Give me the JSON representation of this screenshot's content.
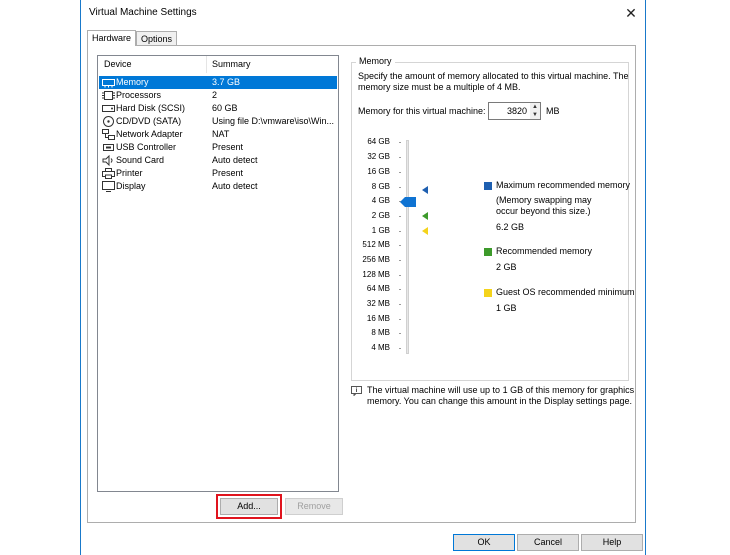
{
  "window": {
    "title": "Virtual Machine Settings"
  },
  "tabs": [
    {
      "label": "Hardware"
    },
    {
      "label": "Options"
    }
  ],
  "device_list": {
    "headers": {
      "device": "Device",
      "summary": "Summary"
    },
    "rows": [
      {
        "device": "Memory",
        "summary": "3.7 GB",
        "icon": "memory-icon",
        "selected": true
      },
      {
        "device": "Processors",
        "summary": "2",
        "icon": "processor-icon"
      },
      {
        "device": "Hard Disk (SCSI)",
        "summary": "60 GB",
        "icon": "hard-disk-icon"
      },
      {
        "device": "CD/DVD (SATA)",
        "summary": "Using file D:\\vmware\\iso\\Win...",
        "icon": "cd-dvd-icon"
      },
      {
        "device": "Network Adapter",
        "summary": "NAT",
        "icon": "network-adapter-icon"
      },
      {
        "device": "USB Controller",
        "summary": "Present",
        "icon": "usb-controller-icon"
      },
      {
        "device": "Sound Card",
        "summary": "Auto detect",
        "icon": "sound-card-icon"
      },
      {
        "device": "Printer",
        "summary": "Present",
        "icon": "printer-icon"
      },
      {
        "device": "Display",
        "summary": "Auto detect",
        "icon": "display-icon"
      }
    ]
  },
  "list_buttons": {
    "add": "Add...",
    "remove": "Remove"
  },
  "memory": {
    "group_label": "Memory",
    "description_line1": "Specify the amount of memory allocated to this virtual machine. The",
    "description_line2": "memory size must be a multiple of 4 MB.",
    "field_label": "Memory for this virtual machine:",
    "value": "3820",
    "unit": "MB",
    "scale_labels": [
      "64 GB",
      "32 GB",
      "16 GB",
      "8 GB",
      "4 GB",
      "2 GB",
      "1 GB",
      "512 MB",
      "256 MB",
      "128 MB",
      "64 MB",
      "32 MB",
      "16 MB",
      "8 MB",
      "4 MB"
    ],
    "legend": {
      "max_label": "Maximum recommended memory",
      "max_note_line1": "(Memory swapping may",
      "max_note_line2": "occur beyond this size.)",
      "max_value": "6.2 GB",
      "rec_label": "Recommended memory",
      "rec_value": "2 GB",
      "guest_label": "Guest OS recommended minimum",
      "guest_value": "1 GB"
    },
    "colors": {
      "max": "#1e5fb0",
      "rec": "#3d9a2b",
      "guest": "#f4d31b",
      "thumb": "#0f73d2"
    },
    "info_line1": "The virtual machine will use up to 1 GB of this memory for graphics",
    "info_line2": "memory. You can change this amount in the Display settings page."
  },
  "footer": {
    "ok": "OK",
    "cancel": "Cancel",
    "help": "Help"
  }
}
